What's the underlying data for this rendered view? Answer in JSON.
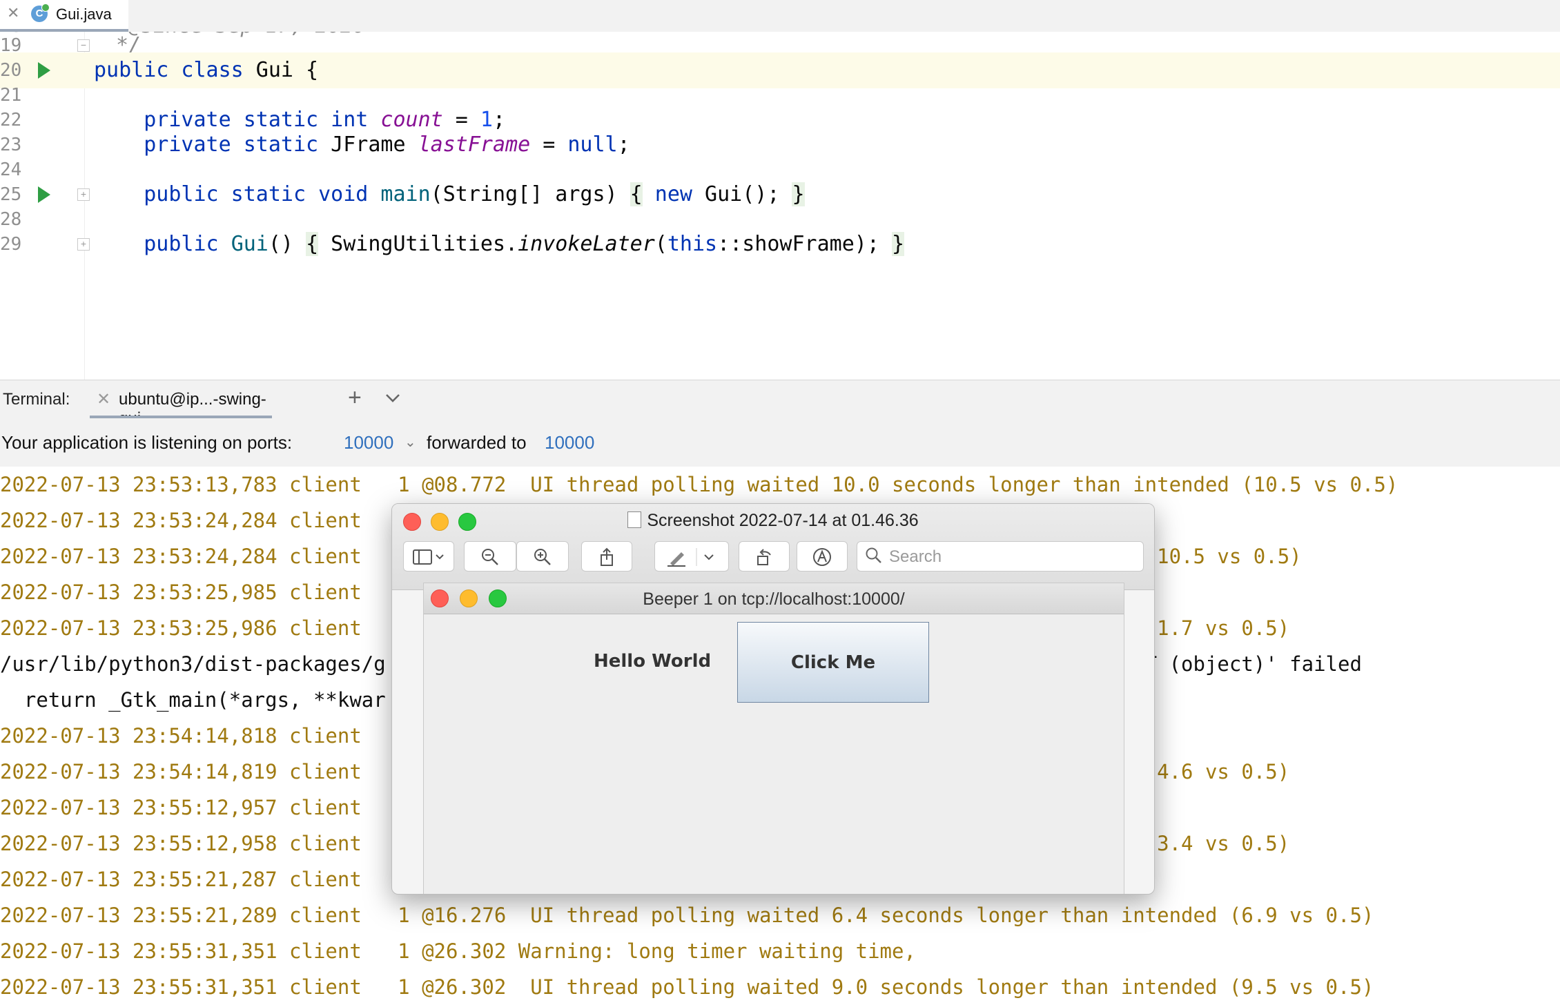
{
  "editor": {
    "file_tab": {
      "close": "✕",
      "icon_letter": "C",
      "label": "Gui.java"
    },
    "lines": [
      {
        "num": "19",
        "text": " */"
      },
      {
        "num": "20",
        "text": "public class Gui {"
      },
      {
        "num": "21",
        "text": ""
      },
      {
        "num": "22",
        "text": "    private static int count = 1;"
      },
      {
        "num": "23",
        "text": "    private static JFrame lastFrame = null;"
      },
      {
        "num": "24",
        "text": ""
      },
      {
        "num": "25",
        "text": "    public static void main(String[] args) { new Gui(); }"
      },
      {
        "num": "28",
        "text": ""
      },
      {
        "num": "29",
        "text": "    public Gui() { SwingUtilities.invokeLater(this::showFrame); }"
      }
    ]
  },
  "terminal": {
    "label": "Terminal:",
    "tab_label": "ubuntu@ip...-swing-gui",
    "add_icon": "+",
    "menu_icon": "⌄",
    "ports_text": "Your application is listening on ports:",
    "port": "10000",
    "forwarded_text": "forwarded to",
    "forwarded_port": "10000",
    "lines": [
      {
        "text": "2022-07-13 23:53:13,783 client   1 @08.772  UI thread polling waited 10.0 seconds longer than intended (10.5 vs 0.5)",
        "kind": "log"
      },
      {
        "text": "2022-07-13 23:53:24,284 client",
        "kind": "log"
      },
      {
        "text": "2022-07-13 23:53:24,284 client                                                        intended (10.5 vs 0.5)",
        "kind": "log"
      },
      {
        "text": "2022-07-13 23:53:25,985 client",
        "kind": "log"
      },
      {
        "text": "2022-07-13 23:53:25,986 client                                                        intended (1.7 vs 0.5)",
        "kind": "log"
      },
      {
        "text": "/usr/lib/python3/dist-packages/g                                                       IS_OBJECT (object)' failed",
        "kind": "plain"
      },
      {
        "text": "  return _Gtk_main(*args, **kwar",
        "kind": "plain"
      },
      {
        "text": "2022-07-13 23:54:14,818 client",
        "kind": "log"
      },
      {
        "text": "2022-07-13 23:54:14,819 client                                                        intended (4.6 vs 0.5)",
        "kind": "log"
      },
      {
        "text": "2022-07-13 23:55:12,957 client",
        "kind": "log"
      },
      {
        "text": "2022-07-13 23:55:12,958 client                                                        intended (3.4 vs 0.5)",
        "kind": "log"
      },
      {
        "text": "2022-07-13 23:55:21,287 client",
        "kind": "log"
      },
      {
        "text": "2022-07-13 23:55:21,289 client   1 @16.276  UI thread polling waited 6.4 seconds longer than intended (6.9 vs 0.5)",
        "kind": "log"
      },
      {
        "text": "2022-07-13 23:55:31,351 client   1 @26.302 Warning: long timer waiting time,",
        "kind": "log"
      },
      {
        "text": "2022-07-13 23:55:31,351 client   1 @26.302  UI thread polling waited 9.0 seconds longer than intended (9.5 vs 0.5)",
        "kind": "log"
      }
    ]
  },
  "preview": {
    "title": "Screenshot 2022-07-14 at 01.46.36",
    "search_placeholder": "Search",
    "toolbar_icons": [
      "sidebar-icon",
      "zoom-out-icon",
      "zoom-in-icon",
      "share-icon",
      "markup-pen-icon",
      "rotate-icon",
      "annotate-icon"
    ],
    "java_window": {
      "title": "Beeper 1 on tcp://localhost:10000/",
      "hello_label": "Hello World",
      "button_label": "Click Me"
    }
  },
  "colors": {
    "keyword": "#0033b3",
    "field": "#871094",
    "log_text": "#a07a11",
    "link": "#2f6fbd"
  }
}
